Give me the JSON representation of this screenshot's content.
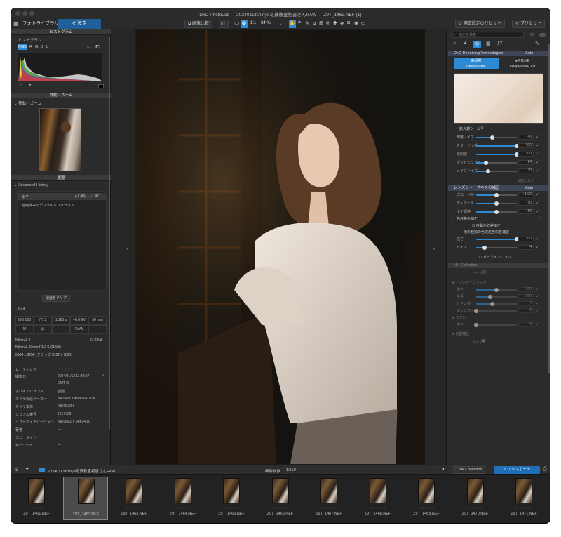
{
  "window": {
    "title": "DxO PhotoLab — 20240113shinya写真教室初音さんRAW — Z9T_1462.NEF (1)"
  },
  "tabs": {
    "library": "フォトライブラリ",
    "customize": "設定"
  },
  "toolbar": {
    "compare": "画像比較",
    "one_to_one": "1:1",
    "zoom": "34 %",
    "reset": "補正設定のリセット",
    "preset": "プリセット"
  },
  "left": {
    "histogram_section": "ヒストグラム",
    "histogram_title": "ヒストグラム",
    "channels": [
      "RGB",
      "R",
      "G",
      "B",
      "L"
    ],
    "navigator_section": "移動／ズーム",
    "navigator_title": "移動／ズーム",
    "history_section": "履歴",
    "advanced_history": "Advanced History",
    "history_items": [
      {
        "label": "水平",
        "value": "(-1.40) → -1.47"
      },
      {
        "label": "適用済みのデフォルトプリセット",
        "value": ""
      }
    ],
    "clear_history": "履歴をクリア",
    "exif_title": "Exif",
    "exif_row1": [
      "ISO 500",
      "ƒ/1.2",
      "1/160 s",
      "+0.0 EV",
      "50 mm"
    ],
    "exif_row2": [
      "M",
      "",
      "—",
      "RAW",
      "—"
    ],
    "camera": "Nikon Z 9",
    "megapixels": "51.4 MB",
    "lens": "Nikon Z 50mm F1.2 S (RAW)",
    "dims": "5504 x 8256 (クロップ 5107 x 7821)",
    "metadata": [
      {
        "k": "レーティング",
        "v": "☆☆☆☆☆"
      },
      {
        "k": "撮影日",
        "v": "2024/01/13 11:48:57"
      },
      {
        "k": "",
        "v": "GMT+9"
      },
      {
        "k": "ホワイトバランス",
        "v": "自動"
      },
      {
        "k": "カメラ製造メーカー",
        "v": "NIKON CORPORATION"
      },
      {
        "k": "カメラ本体",
        "v": "NIKON Z 9"
      },
      {
        "k": "シリアル番号",
        "v": "2017739"
      },
      {
        "k": "ソフトウェアバージョン",
        "v": "NIKON Z 9 Ver.04.10"
      },
      {
        "k": "著者",
        "v": "—"
      },
      {
        "k": "コピーライト",
        "v": "—"
      },
      {
        "k": "キーワード",
        "v": "—"
      }
    ]
  },
  "right": {
    "search_placeholder": "補正を検索",
    "denoise_title": "DxO Denoising Technologies",
    "denoise_auto": "Auto",
    "quality_high": "高品質",
    "prime": "PRIME",
    "deepprime": "DeepPRIME",
    "deepprime_xd": "DeepPRIME XD",
    "loupe": "拡大鏡ツール",
    "noise_sliders": [
      {
        "label": "輝度ノイズ",
        "value": 40,
        "max": 100
      },
      {
        "label": "カラーノイズ",
        "value": 100,
        "max": 100
      },
      {
        "label": "低周波",
        "value": 100,
        "max": 100
      },
      {
        "label": "デッドピクセル",
        "value": 24,
        "max": 100
      },
      {
        "label": "メイズノイズ",
        "value": 30,
        "max": 100
      }
    ],
    "default_link": "既定に戻す",
    "lens_title": "レンズシャープネスの補正",
    "lens_auto": "Auto",
    "lens_sliders": [
      {
        "label": "グローバル",
        "value": "+1.00",
        "frac": 0.5
      },
      {
        "label": "ディテール",
        "value": "50",
        "frac": 0.5
      },
      {
        "label": "ボケ調整",
        "value": "50",
        "frac": 0.5
      }
    ],
    "ca_title": "色収差の補正",
    "ca_auto": "自動色収差補正",
    "ca_sub": "他の種類の色収差色収差補正",
    "ca_sliders": [
      {
        "label": "強さ",
        "value": "100",
        "frac": 1.0
      },
      {
        "label": "サイズ",
        "value": "4",
        "frac": 0.2
      }
    ],
    "purple_fringe": "パープルフリンジ",
    "nik_title": "Nik Collection",
    "nik_tool": "ツール",
    "unsharp_title": "アンシャープマスク",
    "unsharp_sliders": [
      {
        "label": "強さ",
        "value": "100",
        "frac": 0.5
      },
      {
        "label": "半径",
        "value": "0.50",
        "frac": 0.35
      },
      {
        "label": "しきい値",
        "value": "4",
        "frac": 0.4
      },
      {
        "label": "エッジフォロー",
        "value": "0",
        "frac": 0.0
      }
    ],
    "blur_title": "モアレ",
    "blur_slider": {
      "label": "強さ",
      "value": "0",
      "frac": 0.0
    },
    "selective_title": "色調補正",
    "selective_label": "マスク"
  },
  "filmbar": {
    "folder": "20240113shinya写真教室初音さんRAW",
    "count": "画像枚数：",
    "count_value": "1/150",
    "nik": "Nik Collection",
    "export": "エクスポート"
  },
  "filmstrip": [
    "Z9T_1461.NEF",
    "Z9T_1462.NEF",
    "Z9T_1463.NEF",
    "Z9T_1464.NEF",
    "Z9T_1465.NEF",
    "Z9T_1466.NEF",
    "Z9T_1467.NEF",
    "Z9T_1468.NEF",
    "Z9T_1469.NEF",
    "Z9T_1470.NEF",
    "Z9T_1471.NEF"
  ],
  "stars": "☆☆☆☆☆",
  "colors": {
    "accent": "#2d8bd6",
    "export": "#1f6fb8",
    "section": "#3e4656"
  }
}
